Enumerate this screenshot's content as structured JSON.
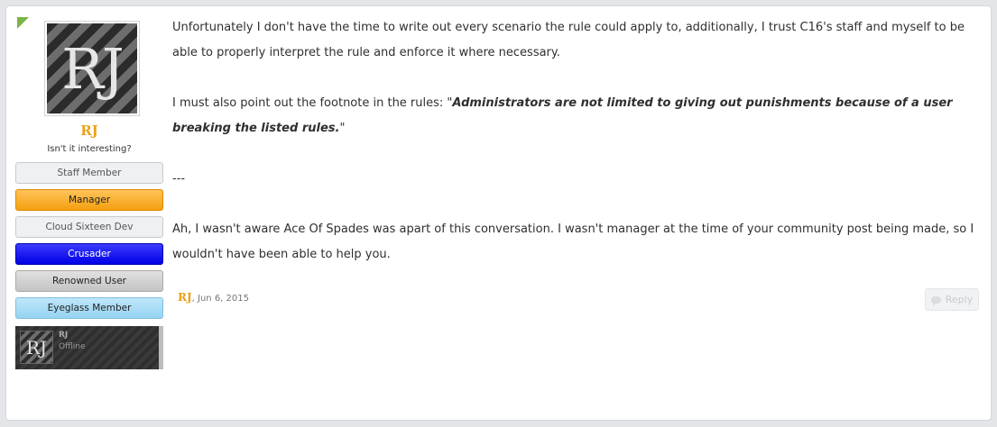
{
  "user": {
    "avatar_monogram": "RJ",
    "name": "RJ",
    "title": "Isn't it interesting?",
    "banners": [
      "Staff Member",
      "Manager",
      "Cloud Sixteen Dev",
      "Crusader",
      "Renowned User",
      "Eyeglass Member"
    ],
    "card": {
      "name": "RJ",
      "status": "Offline",
      "monogram": "RJ"
    }
  },
  "message": {
    "p1": "Unfortunately I don't have the time to write out every scenario the rule could apply to, additionally, I trust C16's staff and myself to be able to properly interpret the rule and enforce it where necessary.",
    "p2_prefix": "I must also point out the footnote in the rules: \"",
    "p2_quote": "Administrators are not limited to giving out punishments because of a user breaking the listed rules.",
    "p2_suffix": "\"",
    "separator": "---",
    "p3": "Ah, I wasn't aware Ace Of Spades was apart of this conversation. I wasn't manager at the time of your community post being made, so I wouldn't have been able to help you."
  },
  "meta": {
    "author": "RJ",
    "date": ", Jun 6, 2015",
    "reply_label": "Reply"
  },
  "colors": {
    "username": "#e9a21a",
    "new_corner": "#7ab547"
  }
}
